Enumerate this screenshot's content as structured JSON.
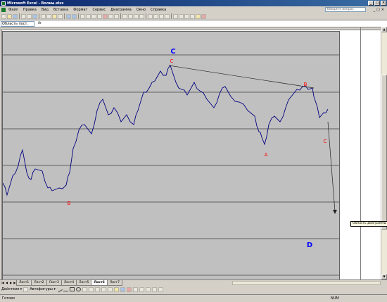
{
  "window": {
    "title": "Microsoft Excel - Волны.xlsx"
  },
  "menu": {
    "items": [
      "Файл",
      "Правка",
      "Вид",
      "Вставка",
      "Формат",
      "Сервис",
      "Диаграмма",
      "Окно",
      "Справка"
    ],
    "ask_placeholder": "Введите вопрос"
  },
  "formula_bar": {
    "name_box": "Область пост.",
    "fx": "fx"
  },
  "chart": {
    "line_color": "#00007f",
    "plot_bg": "#c0c0c0",
    "gridline_values": [
      16,
      14,
      12,
      10,
      8,
      6,
      4
    ],
    "labels": [
      {
        "text": "C",
        "color": "#0000ff",
        "big": true
      },
      {
        "text": "C",
        "color": "#ff0000"
      },
      {
        "text": "B",
        "color": "#ff0000"
      },
      {
        "text": "A",
        "color": "#ff0000"
      },
      {
        "text": "C",
        "color": "#ff0000"
      },
      {
        "text": "B",
        "color": "#ff0000"
      },
      {
        "text": "D",
        "color": "#0000ff",
        "big": true
      }
    ]
  },
  "tooltip": "Область диаграммы",
  "sheets": {
    "tabs": [
      "Лист1",
      "Лист2",
      "Лист3",
      "Лист4",
      "Лист5",
      "Лист6",
      "Лист7"
    ],
    "active": "Лист6"
  },
  "drawing": {
    "actions": "Действия ▾",
    "autoshapes": "Автофигуры ▾"
  },
  "status": {
    "left": "Готово",
    "num": "NUM"
  }
}
